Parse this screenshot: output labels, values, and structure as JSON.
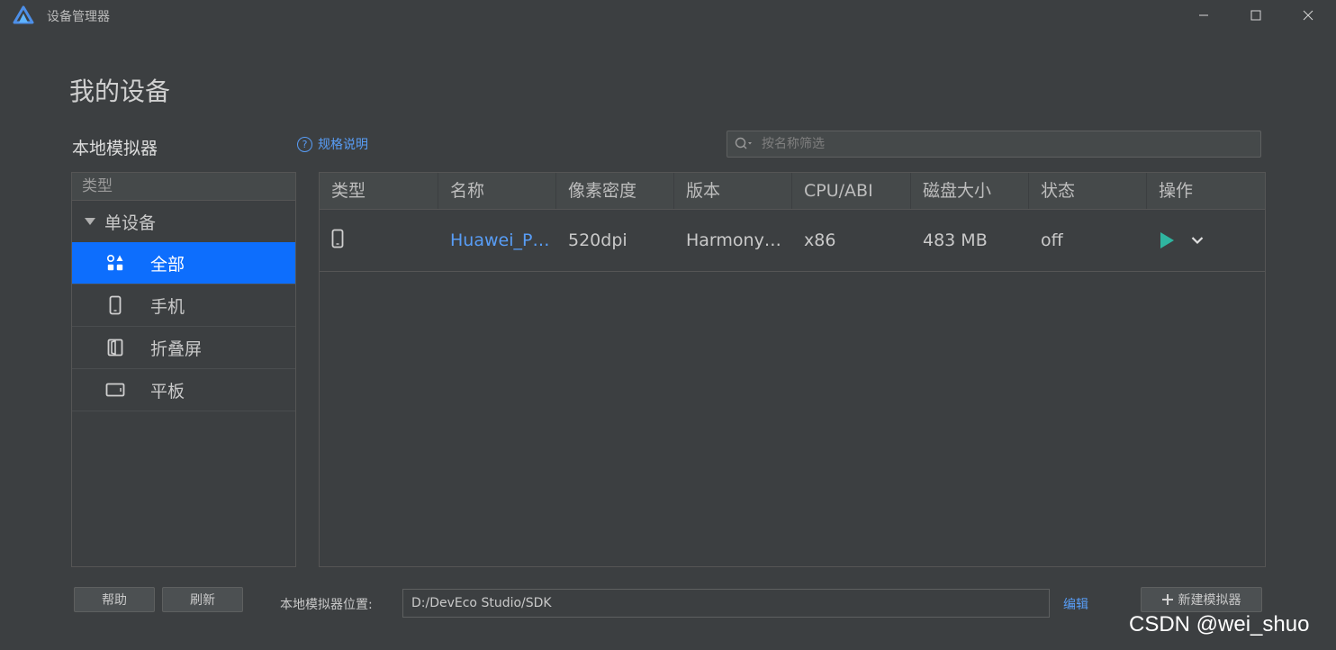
{
  "window": {
    "title": "设备管理器",
    "controls": [
      "minimize-icon",
      "maximize-icon",
      "close-icon"
    ]
  },
  "page": {
    "title": "我的设备",
    "section_title": "本地模拟器",
    "spec_link": "规格说明"
  },
  "search": {
    "placeholder": "按名称筛选",
    "value": ""
  },
  "categories": {
    "header": "类型",
    "group": "单设备",
    "items": [
      {
        "label": "全部",
        "icon": "grid-icon",
        "active": true
      },
      {
        "label": "手机",
        "icon": "phone-icon",
        "active": false
      },
      {
        "label": "折叠屏",
        "icon": "foldable-icon",
        "active": false
      },
      {
        "label": "平板",
        "icon": "tablet-icon",
        "active": false
      }
    ]
  },
  "table": {
    "columns": [
      "类型",
      "名称",
      "像素密度",
      "版本",
      "CPU/ABI",
      "磁盘大小",
      "状态",
      "操作"
    ],
    "rows": [
      {
        "type_icon": "phone-icon",
        "name": "Huawei_P…",
        "density": "520dpi",
        "version": "Harmony…",
        "cpu": "x86",
        "disk": "483 MB",
        "status": "off",
        "actions": [
          "play-icon",
          "chevron-down-icon"
        ]
      }
    ]
  },
  "footer": {
    "help_label": "帮助",
    "refresh_label": "刷新",
    "location_label": "本地模拟器位置:",
    "location_value": "D:/DevEco Studio/SDK",
    "edit_label": "编辑",
    "new_emulator_label": "新建模拟器"
  },
  "watermark": "CSDN @wei_shuo",
  "colors": {
    "background": "#3c3f41",
    "accent": "#0d6efd",
    "link": "#589df6",
    "play": "#2fb5a0"
  }
}
